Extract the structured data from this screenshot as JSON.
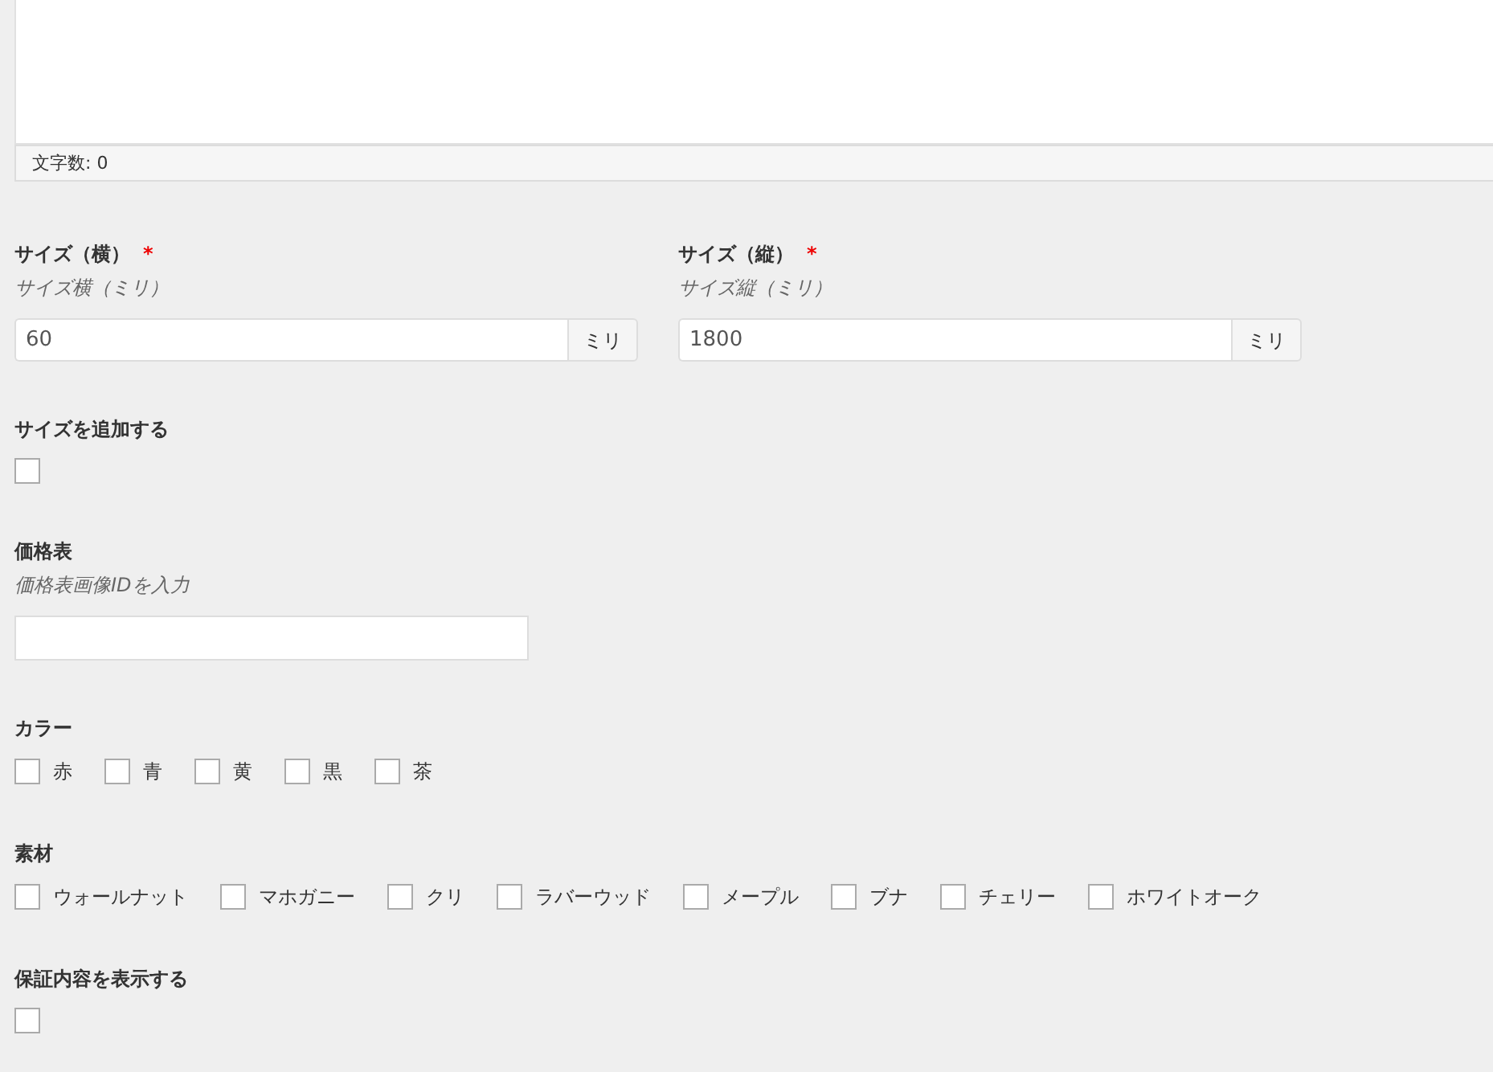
{
  "editor": {
    "word_count": "文字数: 0"
  },
  "fields": [
    {
      "kind": "pair",
      "items": [
        {
          "label": "サイズ（横）",
          "required_mark": "*",
          "description": "サイズ横（ミリ）",
          "value": "60",
          "unit": "ミリ"
        },
        {
          "label": "サイズ（縦）",
          "required_mark": "*",
          "description": "サイズ縦（ミリ）",
          "value": "1800",
          "unit": "ミリ"
        }
      ]
    },
    {
      "kind": "checkbox",
      "label": "サイズを追加する",
      "checked": false
    },
    {
      "kind": "text",
      "label": "価格表",
      "description": "価格表画像IDを入力"
    },
    {
      "kind": "choices",
      "label": "カラー",
      "options": [
        {
          "label": "赤",
          "checked": false
        },
        {
          "label": "青",
          "checked": false
        },
        {
          "label": "黄",
          "checked": false
        },
        {
          "label": "黒",
          "checked": false
        },
        {
          "label": "茶",
          "checked": false
        }
      ]
    },
    {
      "kind": "choices",
      "label": "素材",
      "options": [
        {
          "label": "ウォールナット",
          "checked": false
        },
        {
          "label": "マホガニー",
          "checked": false
        },
        {
          "label": "クリ",
          "checked": false
        },
        {
          "label": "ラバーウッド",
          "checked": false
        },
        {
          "label": "メープル",
          "checked": false
        },
        {
          "label": "ブナ",
          "checked": false
        },
        {
          "label": "チェリー",
          "checked": false
        },
        {
          "label": "ホワイトオーク",
          "checked": false
        }
      ]
    },
    {
      "kind": "checkbox",
      "label": "保証内容を表示する",
      "checked": false
    }
  ]
}
